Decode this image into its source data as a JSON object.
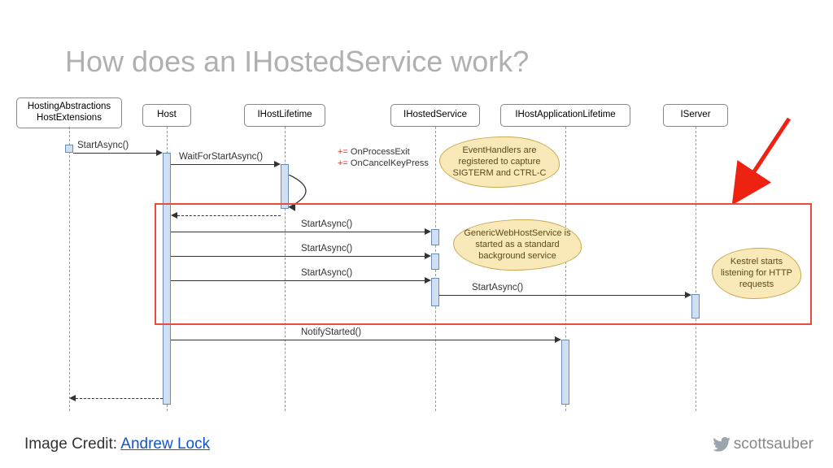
{
  "title": "How does an IHostedService work?",
  "participants": {
    "p1": "HostingAbstractions\nHostExtensions",
    "p2": "Host",
    "p3": "IHostLifetime",
    "p4": "IHostedService",
    "p5": "IHostApplicationLifetime",
    "p6": "IServer"
  },
  "messages": {
    "m1": "StartAsync()",
    "m2": "WaitForStartAsync()",
    "m3": "StartAsync()",
    "m4": "StartAsync()",
    "m5": "StartAsync()",
    "m6": "StartAsync()",
    "m7": "NotifyStarted()"
  },
  "events": {
    "e1_prefix": "+=",
    "e1": "OnProcessExit",
    "e2_prefix": "+=",
    "e2": "OnCancelKeyPress"
  },
  "notes": {
    "n1": "EventHandlers are registered to capture SIGTERM and CTRL-C",
    "n2": "GenericWebHostService is started as a standard background service",
    "n3": "Kestrel starts listening for HTTP requests"
  },
  "credit": {
    "label": "Image Credit: ",
    "link_text": "Andrew Lock"
  },
  "social": {
    "handle": "scottsauber"
  }
}
